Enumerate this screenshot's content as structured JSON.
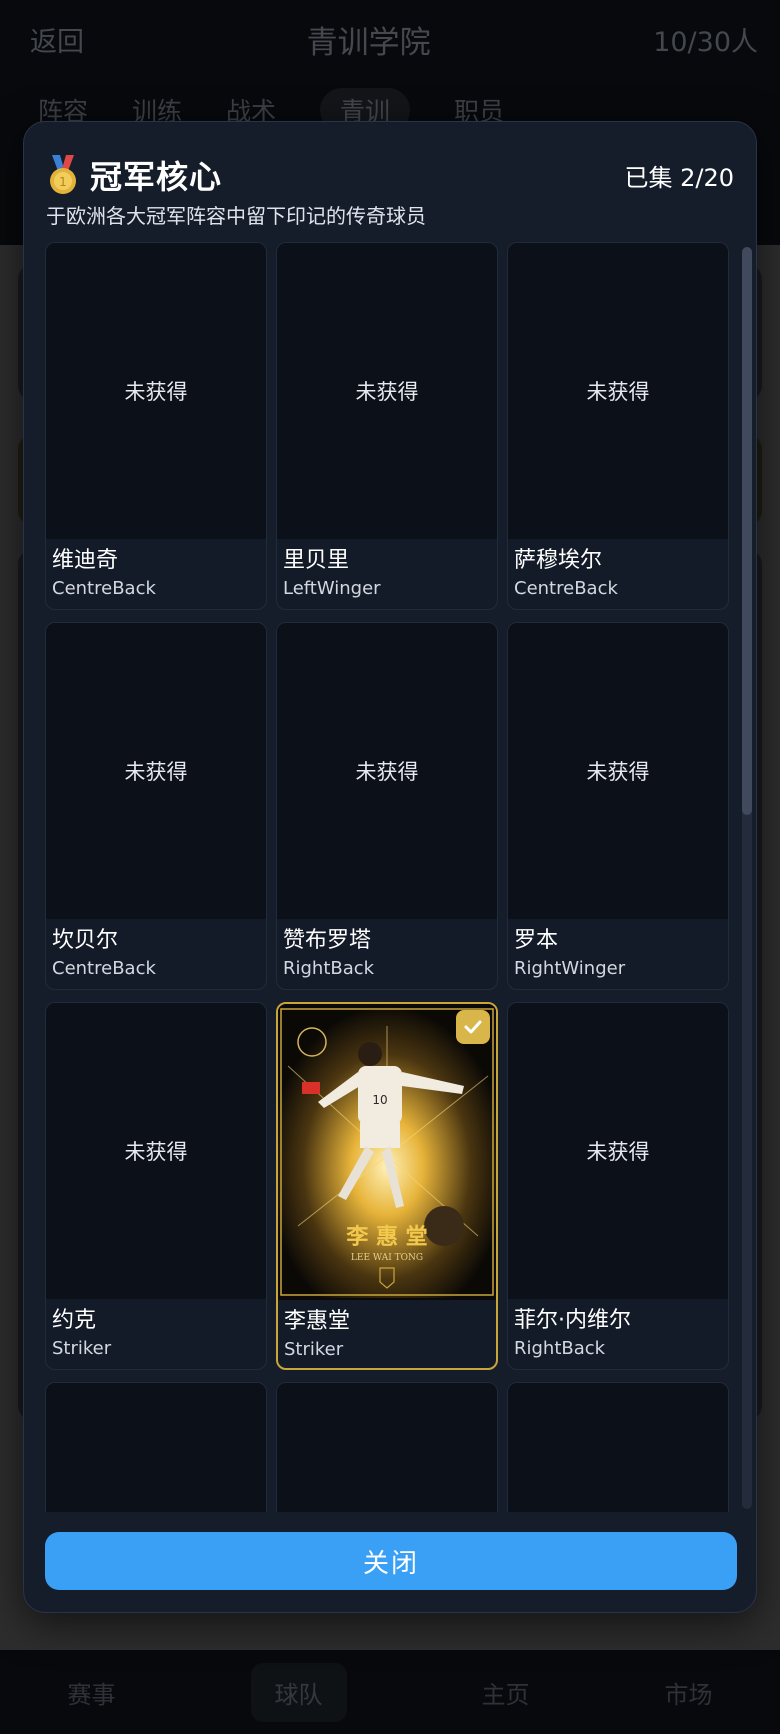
{
  "app": {
    "back_label": "返回",
    "title": "青训学院",
    "capacity": "10/30人",
    "tabs": [
      {
        "label": "阵容"
      },
      {
        "label": "训练"
      },
      {
        "label": "战术"
      },
      {
        "label": "青训",
        "active": true
      },
      {
        "label": "职员"
      }
    ],
    "bottom_nav": [
      {
        "label": "赛事"
      },
      {
        "label": "球队",
        "active": true
      },
      {
        "label": "主页"
      },
      {
        "label": "市场"
      }
    ]
  },
  "modal": {
    "icon": "medal-icon",
    "title": "冠军核心",
    "count": "已集 2/20",
    "subtitle": "于欧洲各大冠军阵容中留下印记的传奇球员",
    "locked_text": "未获得",
    "cards": [
      {
        "name": "维迪奇",
        "position": "CentreBack",
        "owned": false
      },
      {
        "name": "里贝里",
        "position": "LeftWinger",
        "owned": false
      },
      {
        "name": "萨穆埃尔",
        "position": "CentreBack",
        "owned": false
      },
      {
        "name": "坎贝尔",
        "position": "CentreBack",
        "owned": false
      },
      {
        "name": "赞布罗塔",
        "position": "RightBack",
        "owned": false
      },
      {
        "name": "罗本",
        "position": "RightWinger",
        "owned": false
      },
      {
        "name": "约克",
        "position": "Striker",
        "owned": false
      },
      {
        "name": "李惠堂",
        "position": "Striker",
        "owned": true,
        "art_title": "李 惠 堂",
        "art_subtitle": "LEE WAI TONG",
        "art_number": "10"
      },
      {
        "name": "菲尔·内维尔",
        "position": "RightBack",
        "owned": false
      },
      {
        "name": "",
        "position": "",
        "owned": false
      },
      {
        "name": "",
        "position": "",
        "owned": false
      },
      {
        "name": "",
        "position": "",
        "owned": false
      }
    ],
    "close_label": "关闭"
  },
  "colors": {
    "accent": "#3aa0f6",
    "gold": "#c9a63a",
    "modal_bg": "#161d2a"
  }
}
